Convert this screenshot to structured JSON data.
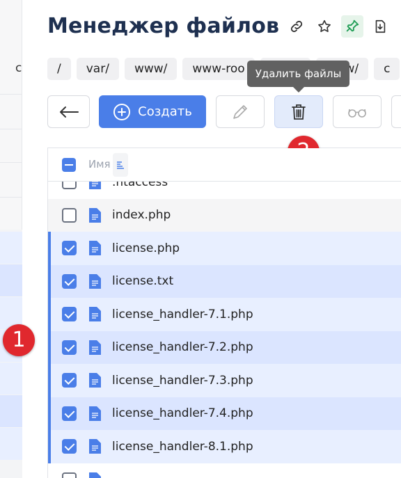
{
  "header": {
    "title": "Менеджер файлов",
    "icons": [
      "link-icon",
      "star-icon",
      "pin-icon",
      "download-icon"
    ],
    "pin_active_color": "#1f9d55"
  },
  "breadcrumbs": [
    "/",
    "var/",
    "www/",
    "www-roo",
    "",
    "www/",
    "c"
  ],
  "left_strip_char": "c",
  "tooltip": "Удалить файлы",
  "toolbar": {
    "create_label": "Создать",
    "accent": "#4a7ee8"
  },
  "table": {
    "column_name": "Имя",
    "rows": [
      {
        "name": ".htaccess",
        "checked": false
      },
      {
        "name": "index.php",
        "checked": false
      },
      {
        "name": "license.php",
        "checked": true
      },
      {
        "name": "license.txt",
        "checked": true
      },
      {
        "name": "license_handler-7.1.php",
        "checked": true
      },
      {
        "name": "license_handler-7.2.php",
        "checked": true
      },
      {
        "name": "license_handler-7.3.php",
        "checked": true
      },
      {
        "name": "license_handler-7.4.php",
        "checked": true
      },
      {
        "name": "license_handler-8.1.php",
        "checked": true
      },
      {
        "name": "",
        "checked": false
      }
    ]
  },
  "markers": {
    "m1": "1",
    "m2": "2",
    "color": "#e0282e"
  }
}
